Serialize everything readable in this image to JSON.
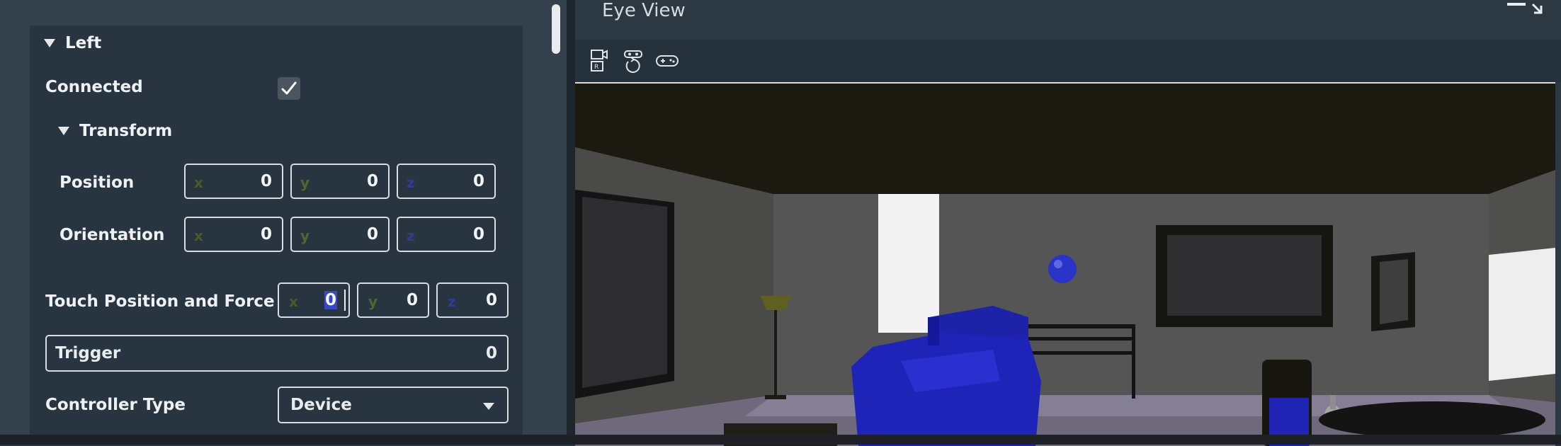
{
  "inspector": {
    "section_left": "Left",
    "connected_label": "Connected",
    "connected_checked": true,
    "transform_label": "Transform",
    "position": {
      "label": "Position",
      "x_axis": "x",
      "x": "0",
      "y_axis": "y",
      "y": "0",
      "z_axis": "z",
      "z": "0"
    },
    "orientation": {
      "label": "Orientation",
      "x_axis": "x",
      "x": "0",
      "y_axis": "y",
      "y": "0",
      "z_axis": "z",
      "z": "0"
    },
    "touch": {
      "label": "Touch Position and Force",
      "x_axis": "x",
      "x": "0",
      "y_axis": "y",
      "y": "0",
      "z_axis": "z",
      "z": "0"
    },
    "trigger": {
      "label": "Trigger",
      "value": "0"
    },
    "controller_type": {
      "label": "Controller Type",
      "value": "Device"
    }
  },
  "eye_view": {
    "title": "Eye View",
    "tools": [
      "record-video-icon",
      "rotate-view-icon",
      "gamepad-icon"
    ]
  },
  "colors": {
    "panel_bg": "#34414c",
    "inner_bg": "#283540",
    "axis_x": "#4c5a2a",
    "axis_y": "#53662a",
    "axis_z": "#2f3c96",
    "couch": "#1f24b8",
    "ball": "#2a34c8"
  }
}
